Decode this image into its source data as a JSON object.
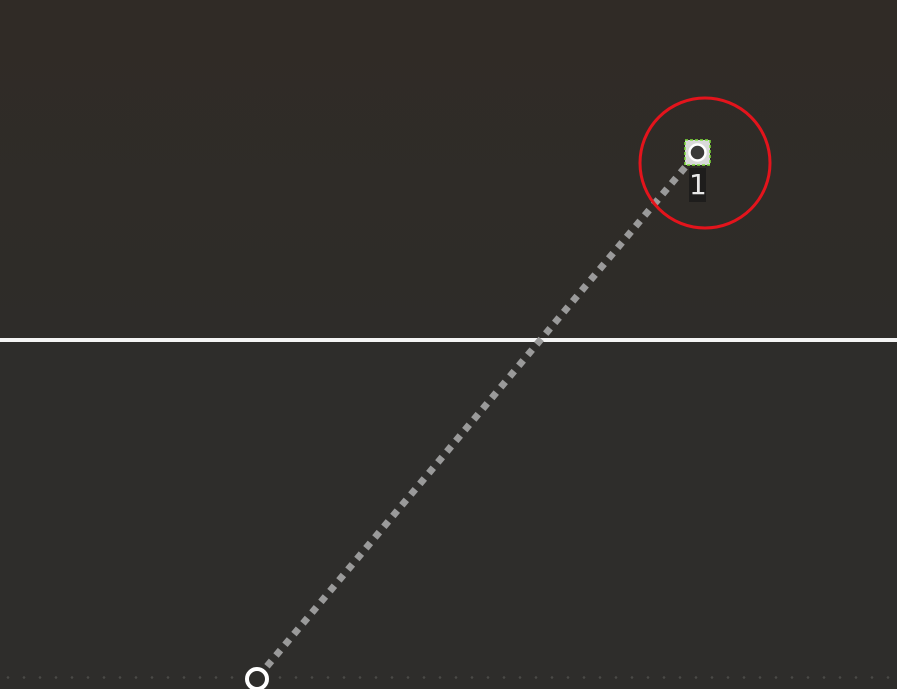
{
  "annotation": {
    "point_label": "1"
  },
  "colors": {
    "highlight_circle": "#e3141c",
    "connector_line": "#9a9a9a",
    "handle_border": "#7fe03a",
    "divider": "#f4f4f4"
  }
}
